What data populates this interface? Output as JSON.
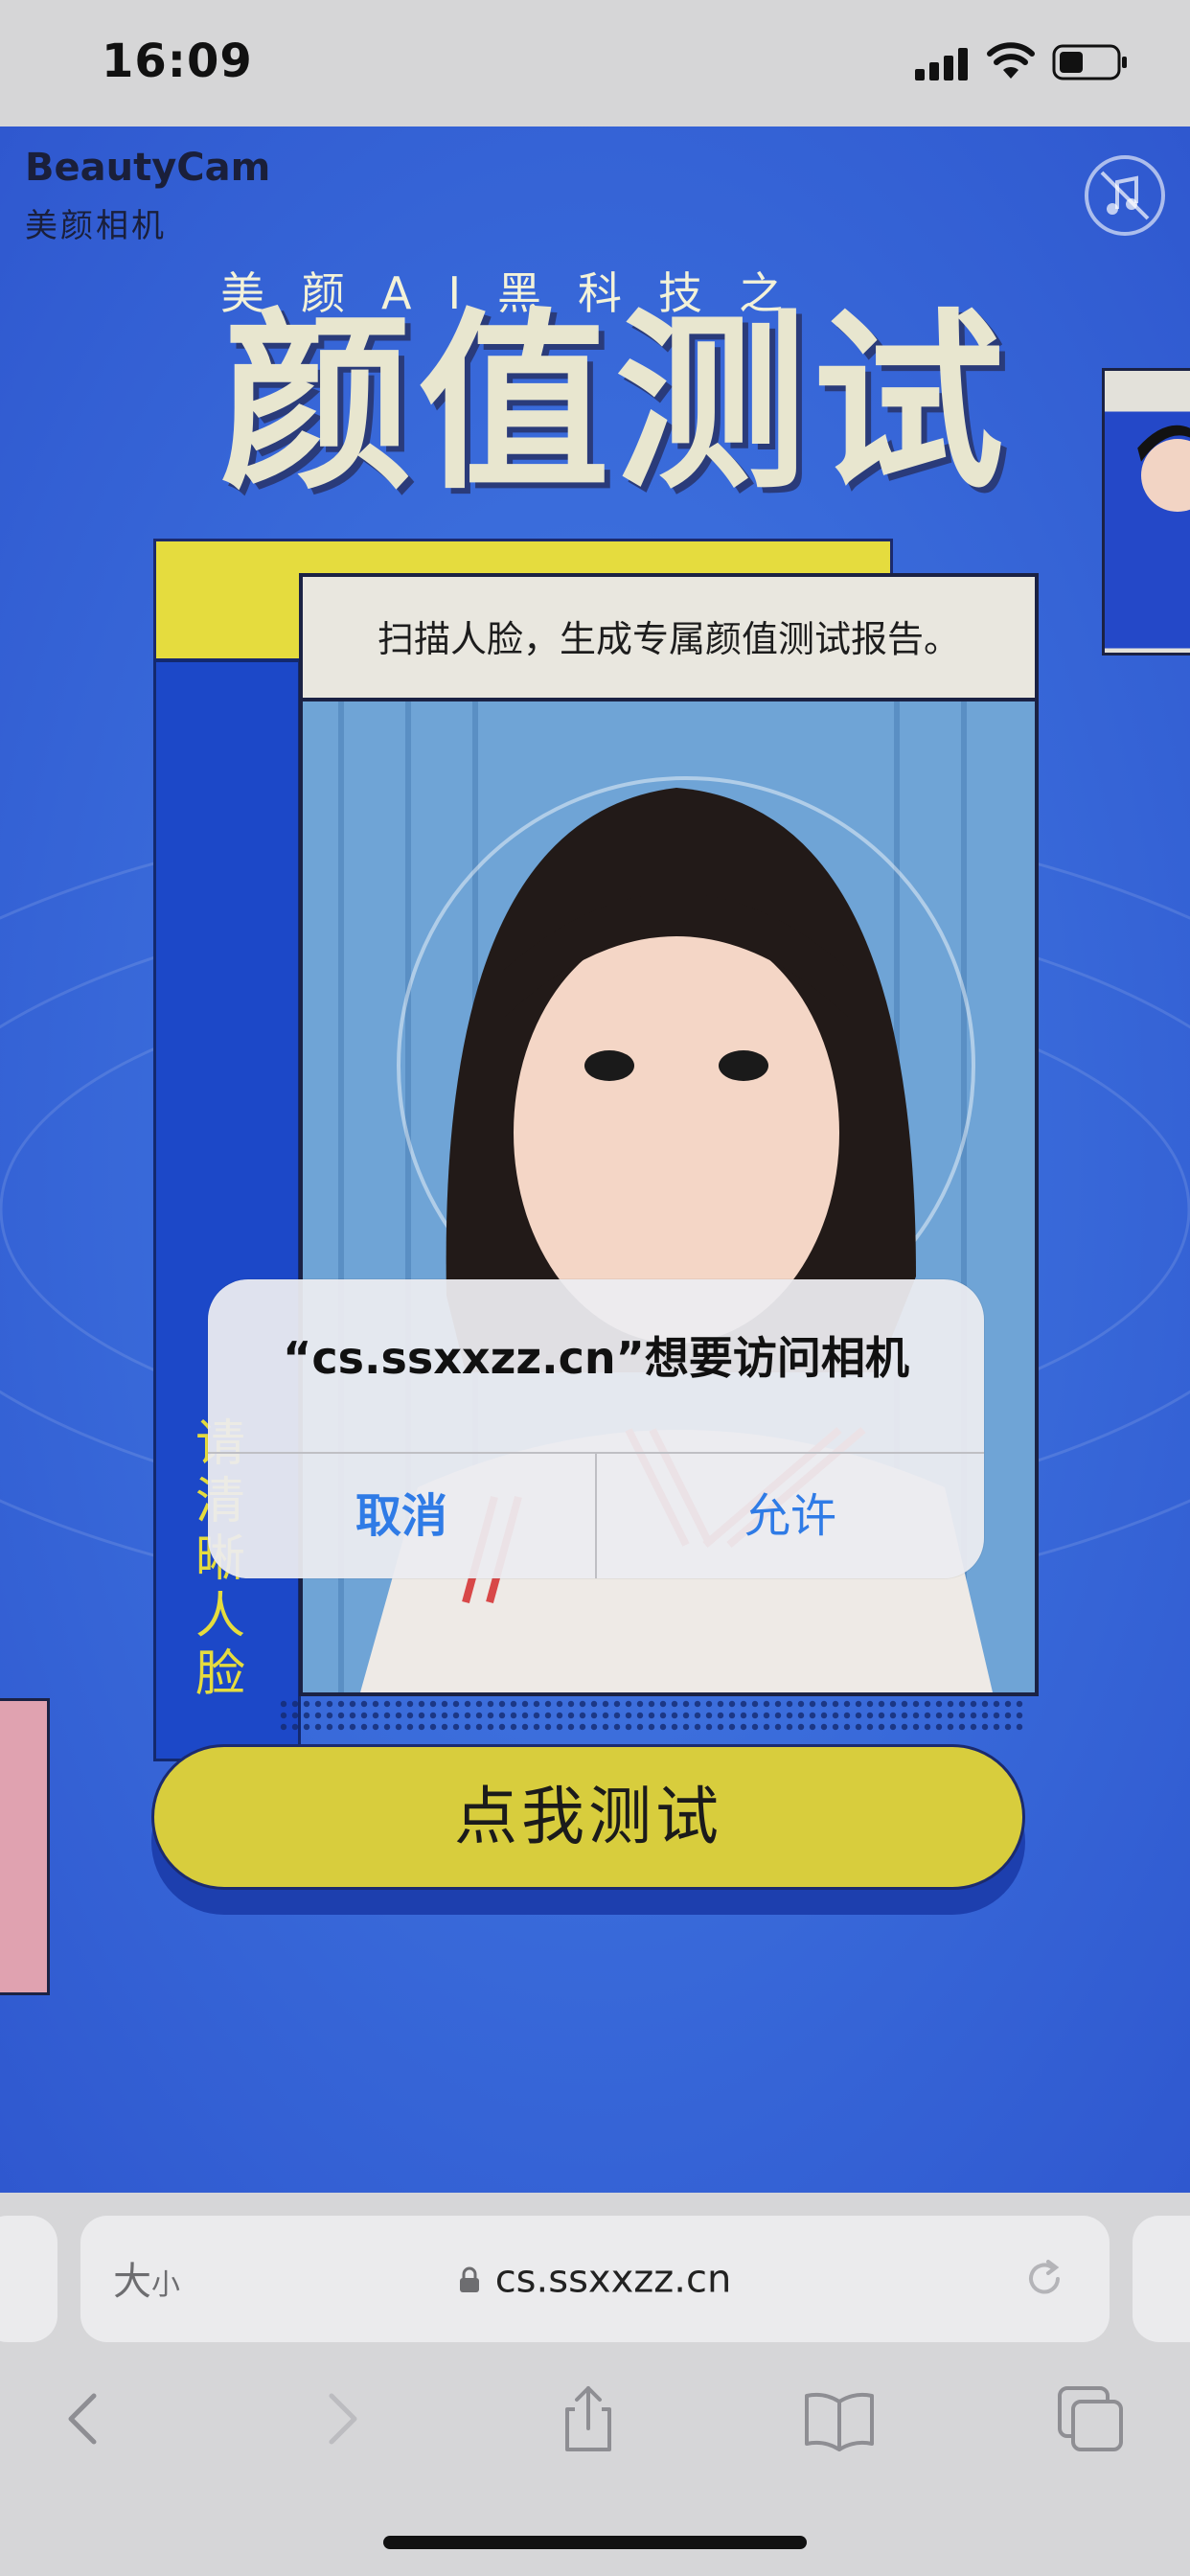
{
  "status_bar": {
    "time": "16:09"
  },
  "page": {
    "brand_en": "BeautyCam",
    "brand_cn": "美颜相机",
    "headline_sub": "美颜AI黑科技之",
    "headline_main": "颜值测试",
    "photo_caption": "扫描人脸，生成专属颜值测试报告。",
    "side_vertical_text": "请清晰人脸",
    "test_button": "点我测试"
  },
  "alert": {
    "title": "“cs.ssxxzz.cn”想要访问相机",
    "cancel": "取消",
    "allow": "允许"
  },
  "browser": {
    "text_size_large": "大",
    "text_size_small": "小",
    "url": "cs.ssxxzz.cn"
  },
  "colors": {
    "page_blue": "#3a6cdb",
    "accent_yellow": "#d8cd3d",
    "link_blue": "#2f7be6"
  }
}
